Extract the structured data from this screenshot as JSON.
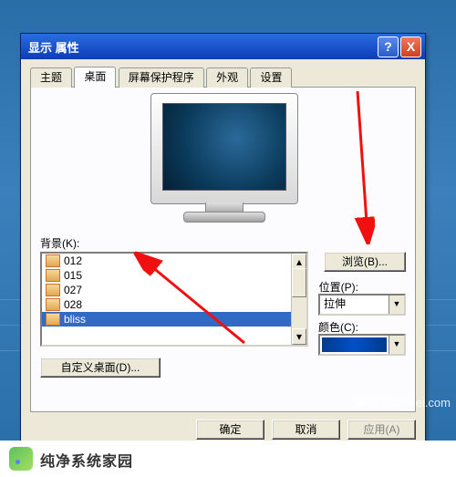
{
  "dialog": {
    "title": "显示 属性",
    "help_icon": "?",
    "close_icon": "X"
  },
  "tabs": [
    {
      "label": "主题",
      "sel": false
    },
    {
      "label": "桌面",
      "sel": true
    },
    {
      "label": "屏幕保护程序",
      "sel": false
    },
    {
      "label": "外观",
      "sel": false
    },
    {
      "label": "设置",
      "sel": false
    }
  ],
  "background": {
    "label": "背景(K):",
    "items": [
      "012",
      "015",
      "027",
      "028",
      "bliss"
    ],
    "selected_index": 4,
    "browse_label": "浏览(B)..."
  },
  "position": {
    "label": "位置(P):",
    "value": "拉伸"
  },
  "color": {
    "label": "颜色(C):",
    "value_hex": "#003a8c"
  },
  "customize_desktop_label": "自定义桌面(D)...",
  "buttons": {
    "ok": "确定",
    "cancel": "取消",
    "apply": "应用(A)"
  },
  "watermark": "www.yidaimei.com",
  "logo": {
    "title": "纯净系统家园"
  }
}
